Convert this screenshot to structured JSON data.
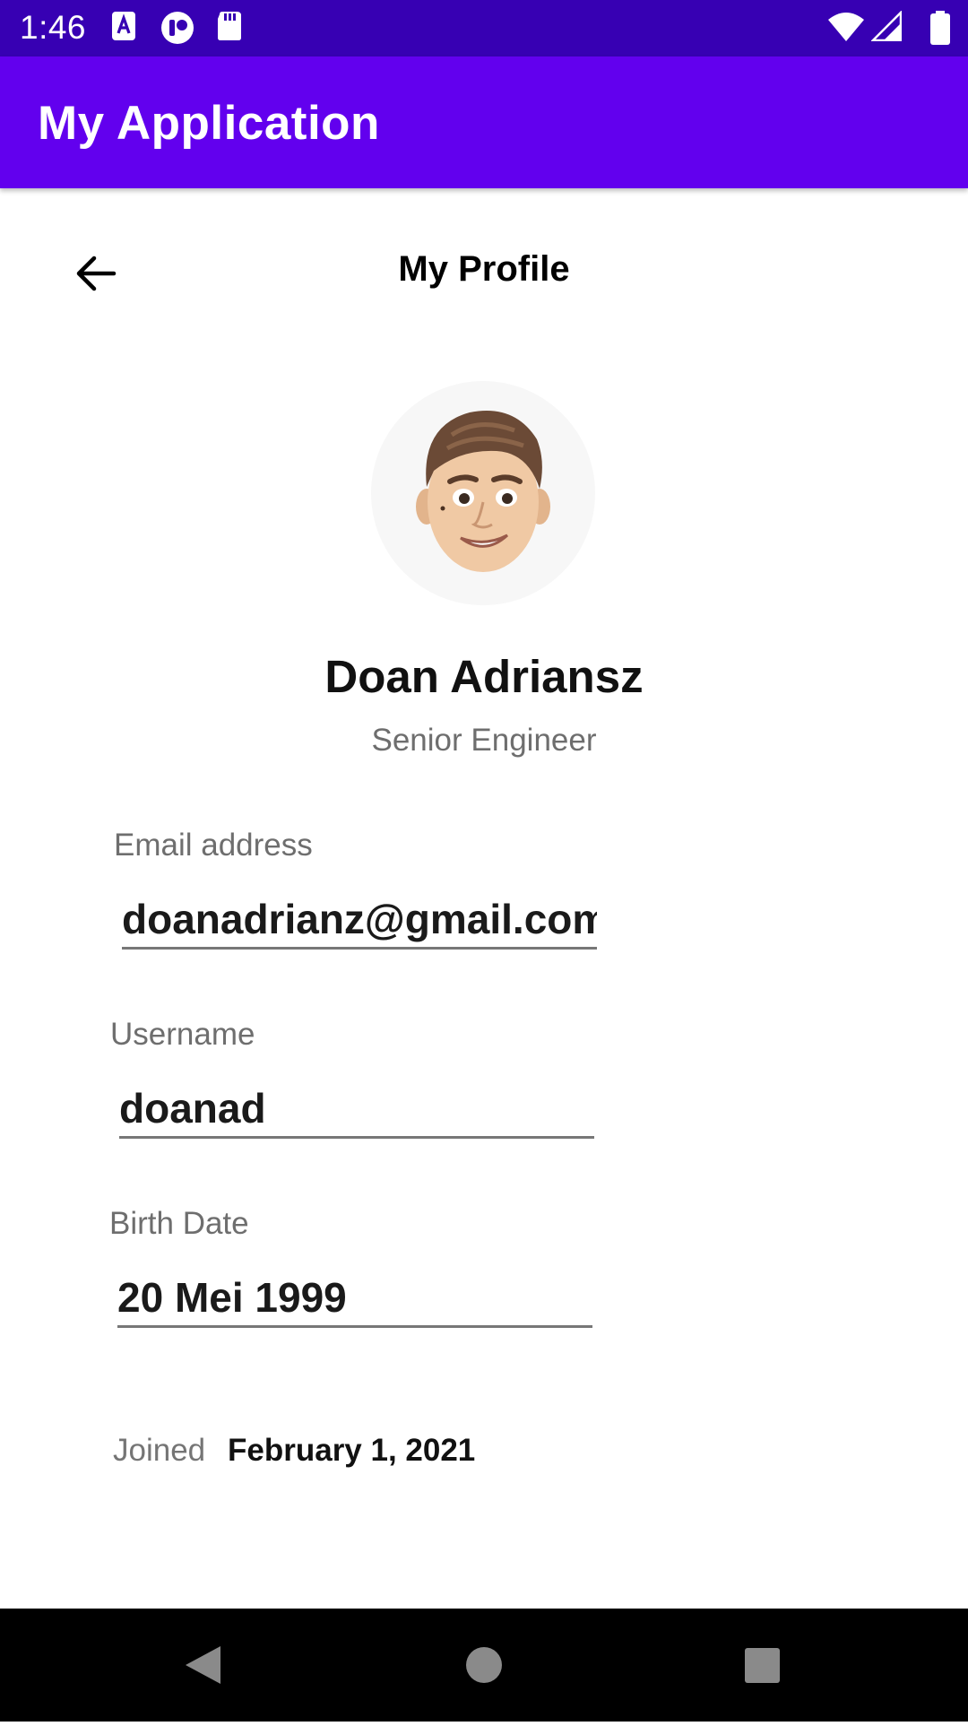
{
  "status_bar": {
    "time": "1:46",
    "left_icons": [
      "accessibility-icon",
      "notification-app-icon",
      "sd-card-icon"
    ],
    "right_icons": [
      "wifi-icon",
      "cell-signal-icon",
      "battery-icon"
    ]
  },
  "app_bar": {
    "title": "My Application"
  },
  "header": {
    "title": "My Profile",
    "back_icon": "arrow-back-icon"
  },
  "profile": {
    "avatar": "avatar-memoji",
    "name": "Doan Adriansz",
    "role": "Senior Engineer"
  },
  "fields": [
    {
      "label": "Email address",
      "value": "doanadrianz@gmail.com"
    },
    {
      "label": "Username",
      "value": "doanad"
    },
    {
      "label": "Birth Date",
      "value": "20 Mei 1999"
    }
  ],
  "joined": {
    "label": "Joined",
    "value": "February 1, 2021"
  },
  "nav_bar": {
    "buttons": [
      "back-triangle-icon",
      "home-circle-icon",
      "recents-square-icon"
    ]
  },
  "colors": {
    "status_bar": "#3700b3",
    "app_bar": "#6200ee",
    "label_gray": "#6e6e6e",
    "nav_bar": "#000000"
  }
}
